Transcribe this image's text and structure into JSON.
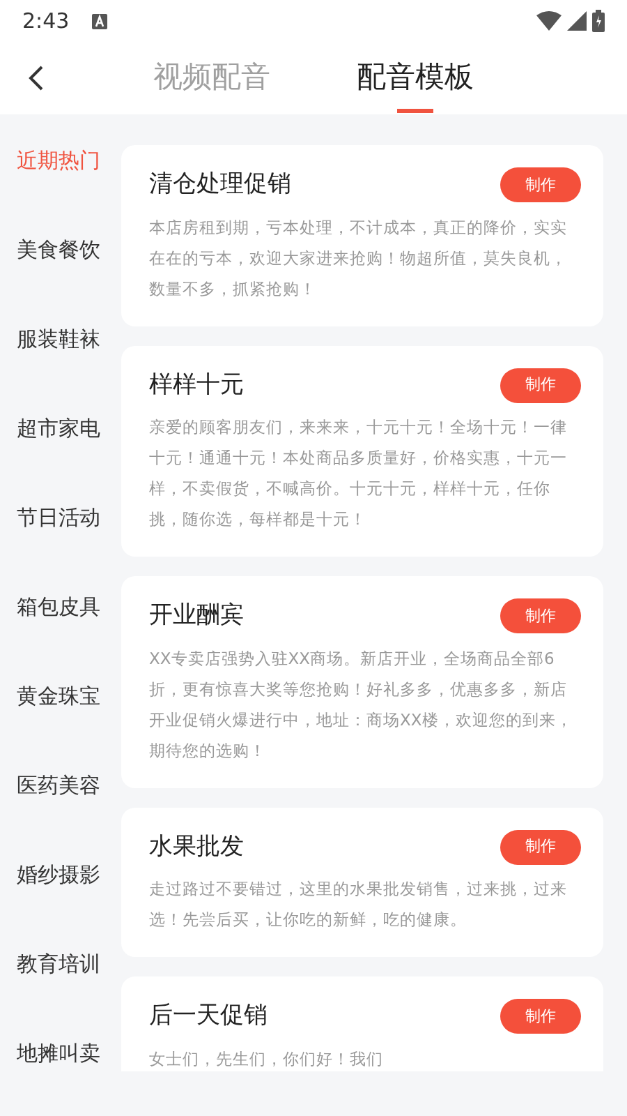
{
  "status_bar": {
    "time": "2:43"
  },
  "header": {
    "tabs": [
      {
        "label": "视频配音",
        "selected": false
      },
      {
        "label": "配音模板",
        "selected": true
      }
    ]
  },
  "sidebar": {
    "items": [
      {
        "label": "近期热门",
        "selected": true
      },
      {
        "label": "美食餐饮",
        "selected": false
      },
      {
        "label": "服装鞋袜",
        "selected": false
      },
      {
        "label": "超市家电",
        "selected": false
      },
      {
        "label": "节日活动",
        "selected": false
      },
      {
        "label": "箱包皮具",
        "selected": false
      },
      {
        "label": "黄金珠宝",
        "selected": false
      },
      {
        "label": "医药美容",
        "selected": false
      },
      {
        "label": "婚纱摄影",
        "selected": false
      },
      {
        "label": "教育培训",
        "selected": false
      },
      {
        "label": "地摊叫卖",
        "selected": false
      }
    ]
  },
  "templates": [
    {
      "title": "清仓处理促销",
      "button": "制作",
      "text": "本店房租到期，亏本处理，不计成本，真正的降价，实实在在的亏本，欢迎大家进来抢购！物超所值，莫失良机，数量不多，抓紧抢购！"
    },
    {
      "title": "样样十元",
      "button": "制作",
      "text": "亲爱的顾客朋友们，来来来，十元十元！全场十元！一律十元！通通十元！本处商品多质量好，价格实惠，十元一样，不卖假货，不喊高价。十元十元，样样十元，任你挑，随你选，每样都是十元！"
    },
    {
      "title": "开业酬宾",
      "button": "制作",
      "text": "XX专卖店强势入驻XX商场。新店开业，全场商品全部6折，更有惊喜大奖等您抢购！好礼多多，优惠多多，新店开业促销火爆进行中，地址：商场XX楼，欢迎您的到来，期待您的选购！"
    },
    {
      "title": "水果批发",
      "button": "制作",
      "text": "走过路过不要错过，这里的水果批发销售，过来挑，过来选！先尝后买，让你吃的新鲜，吃的健康。"
    },
    {
      "title": "后一天促销",
      "button": "制作",
      "text": "女士们，先生们，你们好！我们"
    }
  ]
}
